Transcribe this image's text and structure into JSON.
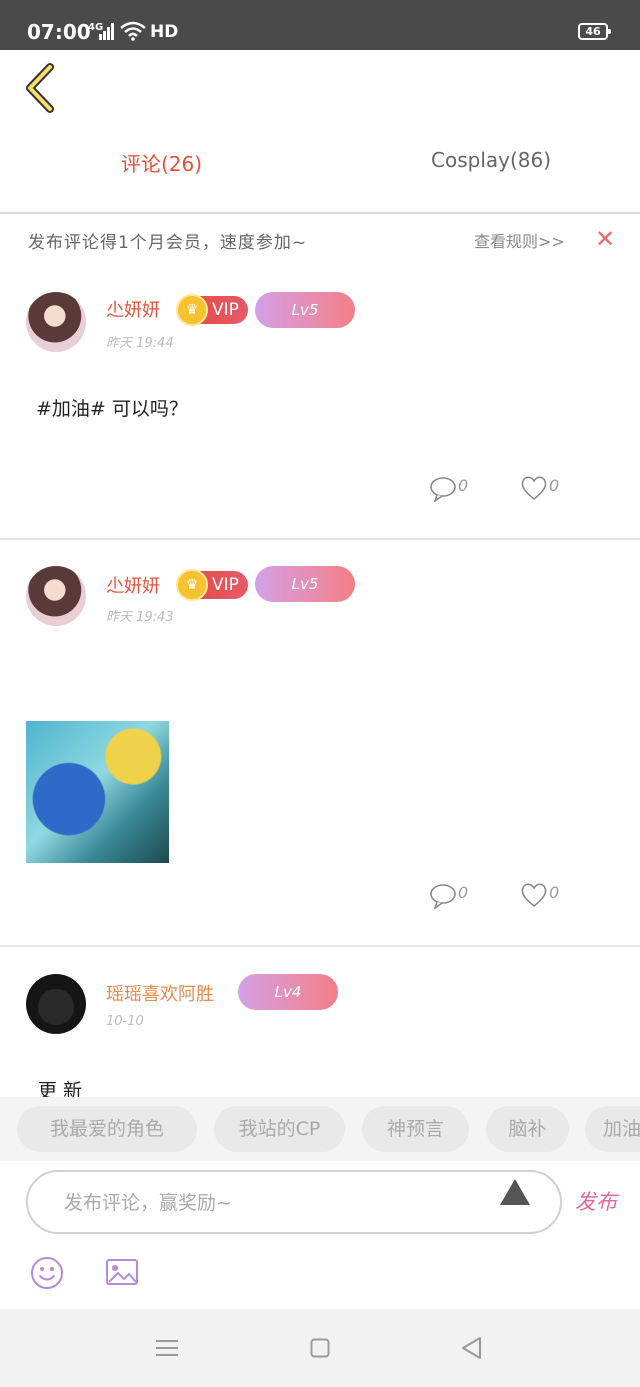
{
  "status_bar": {
    "time": "07:00",
    "network": "4G",
    "hd": "HD",
    "battery": "46"
  },
  "tabs": [
    {
      "label": "评论(26)",
      "active": true
    },
    {
      "label": "Cosplay(86)",
      "active": false
    }
  ],
  "banner": {
    "text": "发布评论得1个月会员，速度参加~",
    "rules_link": "查看规则>>",
    "close": "✕"
  },
  "posts": [
    {
      "username": "尐妍妍",
      "vip": "VIP",
      "level": "Lv5",
      "time": "昨天 19:44",
      "text": "#加油# 可以吗？",
      "comments": "0",
      "likes": "0"
    },
    {
      "username": "尐妍妍",
      "vip": "VIP",
      "level": "Lv5",
      "time": "昨天 19:43",
      "text": "",
      "comments": "0",
      "likes": "0"
    },
    {
      "username": "瑶瑶喜欢阿胜",
      "level": "Lv4",
      "time": "10-10",
      "text": "更新"
    }
  ],
  "chips": [
    "我最爱的角色",
    "我站的CP",
    "神预言",
    "脑补",
    "加油"
  ],
  "composer": {
    "placeholder": "发布评论，赢奖励~",
    "publish": "发布"
  },
  "colors": {
    "accent": "#e8513c",
    "level_gradient": [
      "#d4a0e8",
      "#f47f86"
    ],
    "publish": "#e0689a"
  }
}
